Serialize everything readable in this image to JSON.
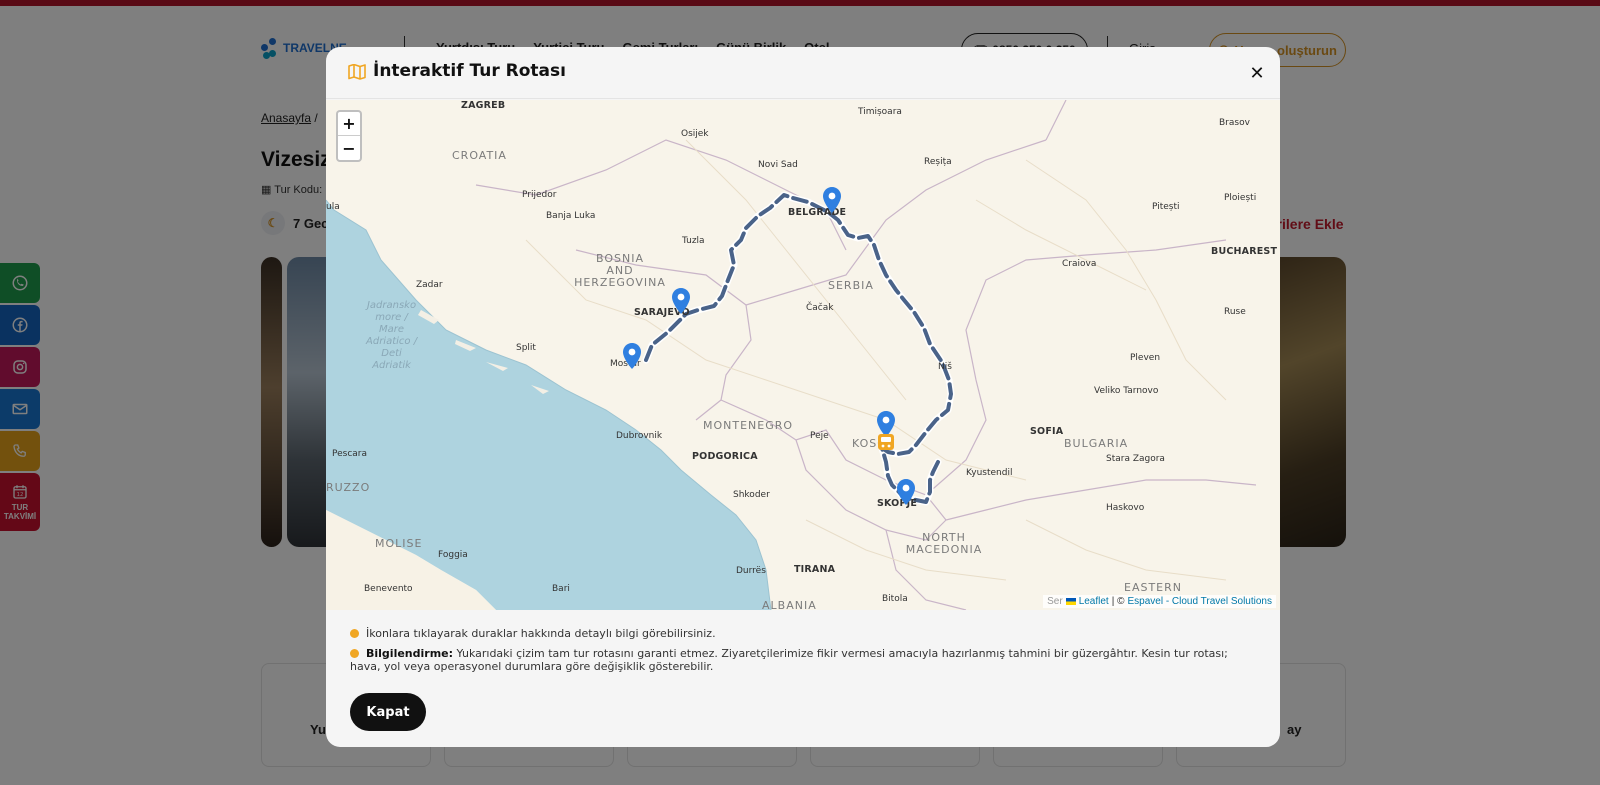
{
  "header": {
    "logo_text": "TRAVELNE",
    "nav": [
      "Yurtdışı Turu",
      "Yurtiçi Turu",
      "Gemi Turları",
      "Günü Birlik",
      "Otel"
    ],
    "phone": "0850 250 0 250",
    "login": "Giriş",
    "create": "Hesap oluşturun"
  },
  "page": {
    "breadcrumb_home": "Anasayfa",
    "breadcrumb_sep": "/",
    "title": "Vizesiz",
    "tour_code_label": "Tur Kodu:",
    "nights": "7 Gec",
    "favorites": "orilere Ekle",
    "card_labels": [
      "Yu",
      "ay"
    ]
  },
  "sidebar": {
    "calendar_label": "TUR\nTAKVİMİ",
    "colors": {
      "whatsapp": "#1f9d4c",
      "facebook": "#1565c0",
      "instagram": "#c2185b",
      "email": "#1976d2",
      "phone": "#e6a21a",
      "calendar": "#c8102e"
    }
  },
  "modal": {
    "title": "İnteraktif Tur Rotası",
    "close": "✕",
    "info_1": "İkonlara tıklayarak duraklar hakkında detaylı bilgi görebilirsiniz.",
    "info_2_label": "Bilgilendirme:",
    "info_2_text": " Yukarıdaki çizim tam tur rotasını garanti etmez. Ziyaretçilerimize fikir vermesi amacıyla hazırlanmış tahmini bir güzergâhtır. Kesin tur rotası; hava, yol veya operasyonel durumlara göre değişiklik gösterebilir.",
    "button": "Kapat",
    "accent": "#f0a623"
  },
  "map": {
    "zoom_in": "+",
    "zoom_out": "−",
    "attribution_leaflet": "Leaflet",
    "attribution_sep": "| ©",
    "attribution_espavel": "Espavel - Cloud Travel Solutions",
    "attribution_pre": "Ser",
    "route_color": "#4a6389",
    "pin_color": "#2f7fe0",
    "bus_color": "#f0a623",
    "countries": [
      "CROATIA",
      "BOSNIA\nAND\nHERZEGOVINA",
      "SERBIA",
      "MONTENEGRO",
      "KOSOV",
      "NORTH\nMACEDONIA",
      "BULGARIA",
      "MOLISE",
      "RUZZO",
      "EASTERN",
      "ALBANIA"
    ],
    "sea": "Jadransko\nmore /\nMare\nAdriatico /\nDeti\nAdriatik",
    "capitals": [
      "ZAGREB",
      "BELGRADE",
      "SARAJEVO",
      "PODGORICA",
      "SKOPJE",
      "SOFIA",
      "BUCHAREST",
      "TIRANA"
    ],
    "cities": [
      "Timișoara",
      "Osijek",
      "Novi Sad",
      "Reșița",
      "Brasov",
      "Prijedor",
      "Banja Luka",
      "Pitești",
      "Ploiești",
      "Tuzla",
      "Craiova",
      "Zadar",
      "Čačak",
      "Ruse",
      "Split",
      "Mostar",
      "Niš",
      "Pleven",
      "Veliko Tarnovo",
      "Dubrovnik",
      "Peje",
      "Pescara",
      "Kyustendil",
      "Stara Zagora",
      "Shkoder",
      "Haskovo",
      "Foggia",
      "Durrës",
      "Benevento",
      "Bari",
      "Bitola",
      "ula"
    ]
  }
}
